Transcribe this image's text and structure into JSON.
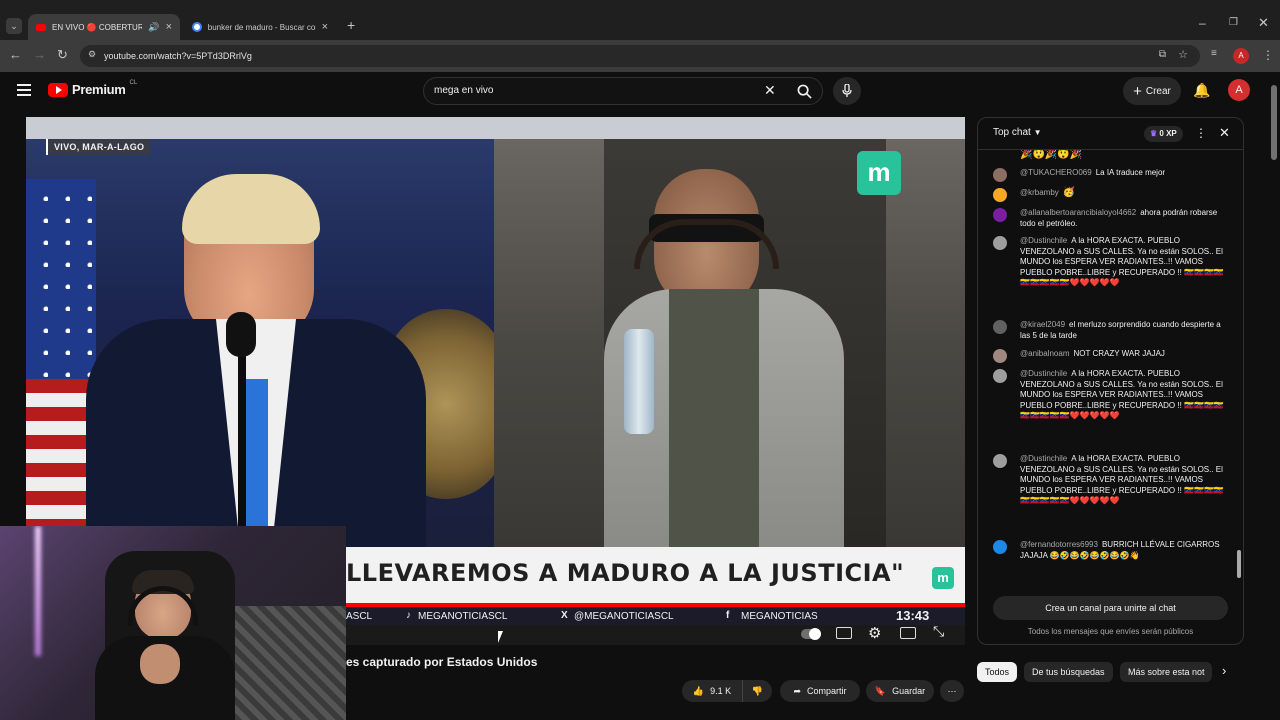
{
  "browser": {
    "tabs": [
      {
        "label": "EN VIVO 🔴 COBERTURA E",
        "active": true
      },
      {
        "label": "bunker de maduro - Buscar con",
        "active": false
      }
    ],
    "url": "youtube.com/watch?v=5PTd3DRrlVg",
    "profile_initial": "A"
  },
  "youtube": {
    "logo_text": "Premium",
    "country": "CL",
    "search_value": "mega en vivo",
    "create_label": "Crear",
    "avatar_initial": "A"
  },
  "video": {
    "location_tag": "VIVO, MAR-A-LAGO",
    "caption": "LLEVAREMOS A MADURO A LA JUSTICIA\"",
    "socials": [
      "ASCL",
      "MEGANOTICIASCL",
      "@MEGANOTICIASCL",
      "MEGANOTICIAS"
    ],
    "clock": "13:43",
    "title": "es capturado por Estados Unidos",
    "likes": "9.1 K",
    "share_label": "Compartir",
    "save_label": "Guardar"
  },
  "chat": {
    "mode": "Top chat",
    "xp": "0 XP",
    "messages": [
      {
        "author": "@TUKACHERO069",
        "text": "La IA traduce mejor",
        "avatar_color": "#8d6e63"
      },
      {
        "author": "@krbamby",
        "text": "🥳",
        "avatar_color": "#f9a825"
      },
      {
        "author": "@allanalbertoarancibialoyol4662",
        "text": "ahora podrán robarse todo el petróleo.",
        "avatar_color": "#7b1fa2"
      },
      {
        "author": "@Dustinchile",
        "text": "A la HORA EXACTA. PUEBLO VENEZOLANO a SUS CALLES. Ya no están SOLOS.. El MUNDO los ESPERA VER RADIANTES..!! VAMOS PUEBLO POBRE..LIBRE y RECUPERADO !! 🇻🇪🇻🇪🇻🇪🇻🇪🇻🇪🇻🇪🇻🇪🇻🇪🇻🇪❤️❤️❤️❤️❤️",
        "avatar_color": "#9e9e9e"
      },
      {
        "author": "@kirael2049",
        "text": "el merluzo sorprendido cuando despierte a las 5 de la tarde",
        "avatar_color": "#616161"
      },
      {
        "author": "@anibalnoam",
        "text": "NOT CRAZY WAR JAJAJ",
        "avatar_color": "#a1887f"
      },
      {
        "author": "@Dustinchile",
        "text": "A la HORA EXACTA. PUEBLO VENEZOLANO a SUS CALLES. Ya no están SOLOS.. El MUNDO los ESPERA VER RADIANTES..!! VAMOS PUEBLO POBRE..LIBRE y RECUPERADO !! 🇻🇪🇻🇪🇻🇪🇻🇪🇻🇪🇻🇪🇻🇪🇻🇪🇻🇪❤️❤️❤️❤️❤️",
        "avatar_color": "#9e9e9e"
      },
      {
        "author": "@Dustinchile",
        "text": "A la HORA EXACTA. PUEBLO VENEZOLANO a SUS CALLES. Ya no están SOLOS.. El MUNDO los ESPERA VER RADIANTES..!! VAMOS PUEBLO POBRE..LIBRE y RECUPERADO !! 🇻🇪🇻🇪🇻🇪🇻🇪🇻🇪🇻🇪🇻🇪🇻🇪🇻🇪❤️❤️❤️❤️❤️",
        "avatar_color": "#9e9e9e"
      },
      {
        "author": "@fernandotorres6993",
        "text": "BURRICH LLÉVALE CIGARROS JAJAJA 😂🤣😂🤣😂🤣😂🤣👋",
        "avatar_color": "#1e88e5"
      }
    ],
    "top_emojis": "🎉😲🎉😲🎉",
    "create_channel": "Crea un canal para unirte al chat",
    "public_note": "Todos los mensajes que envíes serán públicos"
  },
  "chips": [
    "Todos",
    "De tus búsquedas",
    "Más sobre esta not"
  ]
}
